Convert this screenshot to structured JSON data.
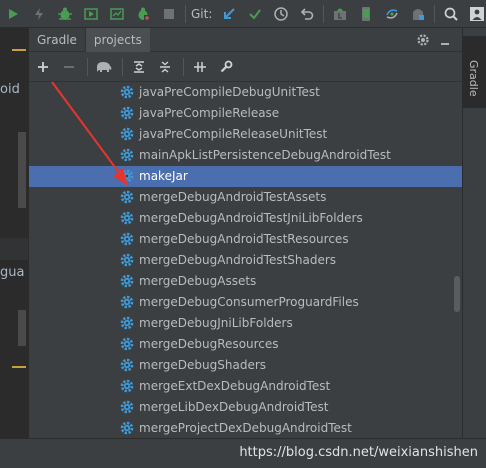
{
  "top_toolbar": {
    "git_label": "Git:",
    "icons": [
      "run-icon",
      "debug-icon",
      "coverage-icon",
      "profile-icon",
      "attach-debugger-icon",
      "stop-icon",
      "vcs-update-icon",
      "vcs-commit-icon",
      "vcs-history-icon",
      "revert-icon",
      "sdk-manager-icon",
      "avd-manager-icon",
      "sync-icon",
      "search-icon",
      "project-structure-icon"
    ]
  },
  "left_editor": {
    "line1": "oid",
    "line2": "gua"
  },
  "gradle_panel": {
    "title": "Gradle",
    "tab": "projects",
    "toolbar_icons": [
      "add-icon",
      "remove-icon",
      "elephant-icon",
      "expand-all-icon",
      "collapse-all-icon",
      "toggle-offline-icon",
      "settings-wrench-icon"
    ],
    "tasks": [
      {
        "label": "javaPreCompileDebugUnitTest",
        "selected": false
      },
      {
        "label": "javaPreCompileRelease",
        "selected": false
      },
      {
        "label": "javaPreCompileReleaseUnitTest",
        "selected": false
      },
      {
        "label": "mainApkListPersistenceDebugAndroidTest",
        "selected": false
      },
      {
        "label": "makeJar",
        "selected": true
      },
      {
        "label": "mergeDebugAndroidTestAssets",
        "selected": false
      },
      {
        "label": "mergeDebugAndroidTestJniLibFolders",
        "selected": false
      },
      {
        "label": "mergeDebugAndroidTestResources",
        "selected": false
      },
      {
        "label": "mergeDebugAndroidTestShaders",
        "selected": false
      },
      {
        "label": "mergeDebugAssets",
        "selected": false
      },
      {
        "label": "mergeDebugConsumerProguardFiles",
        "selected": false
      },
      {
        "label": "mergeDebugJniLibFolders",
        "selected": false
      },
      {
        "label": "mergeDebugResources",
        "selected": false
      },
      {
        "label": "mergeDebugShaders",
        "selected": false
      },
      {
        "label": "mergeExtDexDebugAndroidTest",
        "selected": false
      },
      {
        "label": "mergeLibDexDebugAndroidTest",
        "selected": false
      },
      {
        "label": "mergeProjectDexDebugAndroidTest",
        "selected": false
      }
    ]
  },
  "right_strip": {
    "tab_label": "Gradle"
  },
  "watermark": "https://blog.csdn.net/weixianshishen",
  "colors": {
    "selection": "#4b6eaf",
    "task_icon": "#3d9ad8",
    "arrow": "#e8342f"
  }
}
